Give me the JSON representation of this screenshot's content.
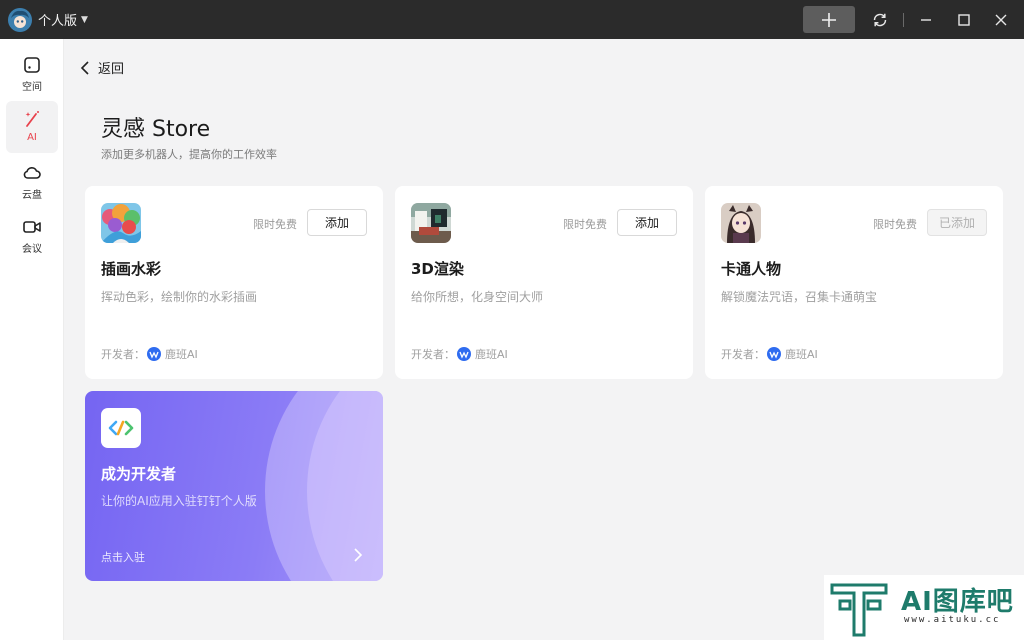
{
  "titlebar": {
    "workspace": "个人版"
  },
  "sidebar": {
    "items": [
      {
        "label": "空间",
        "icon": "space-icon"
      },
      {
        "label": "AI",
        "icon": "ai-wand-icon",
        "active": true
      },
      {
        "label": "云盘",
        "icon": "cloud-icon"
      },
      {
        "label": "会议",
        "icon": "video-icon"
      }
    ]
  },
  "header": {
    "back": "返回",
    "title": "灵感 Store",
    "subtitle": "添加更多机器人，提高你的工作效率"
  },
  "cards": [
    {
      "name": "插画水彩",
      "desc": "挥动色彩，绘制你的水彩插画",
      "badge": "限时免费",
      "button": "添加",
      "added": false,
      "developer_label": "开发者：",
      "developer": "鹿班AI"
    },
    {
      "name": "3D渲染",
      "desc": "给你所想，化身空间大师",
      "badge": "限时免费",
      "button": "添加",
      "added": false,
      "developer_label": "开发者：",
      "developer": "鹿班AI"
    },
    {
      "name": "卡通人物",
      "desc": "解锁魔法咒语，召集卡通萌宝",
      "badge": "限时免费",
      "button": "已添加",
      "added": true,
      "developer_label": "开发者：",
      "developer": "鹿班AI"
    }
  ],
  "developer_card": {
    "title": "成为开发者",
    "subtitle": "让你的AI应用入驻钉钉个人版",
    "cta": "点击入驻"
  },
  "watermark": {
    "text": "AI图库吧",
    "url": "www.aituku.cc"
  },
  "colors": {
    "accent_red": "#e8424c",
    "titlebar_bg": "#2b2b2b",
    "developer_card_purple": "#7565f2",
    "developer_logo_blue": "#2f6cf0",
    "watermark_green": "#1e7b6b"
  }
}
